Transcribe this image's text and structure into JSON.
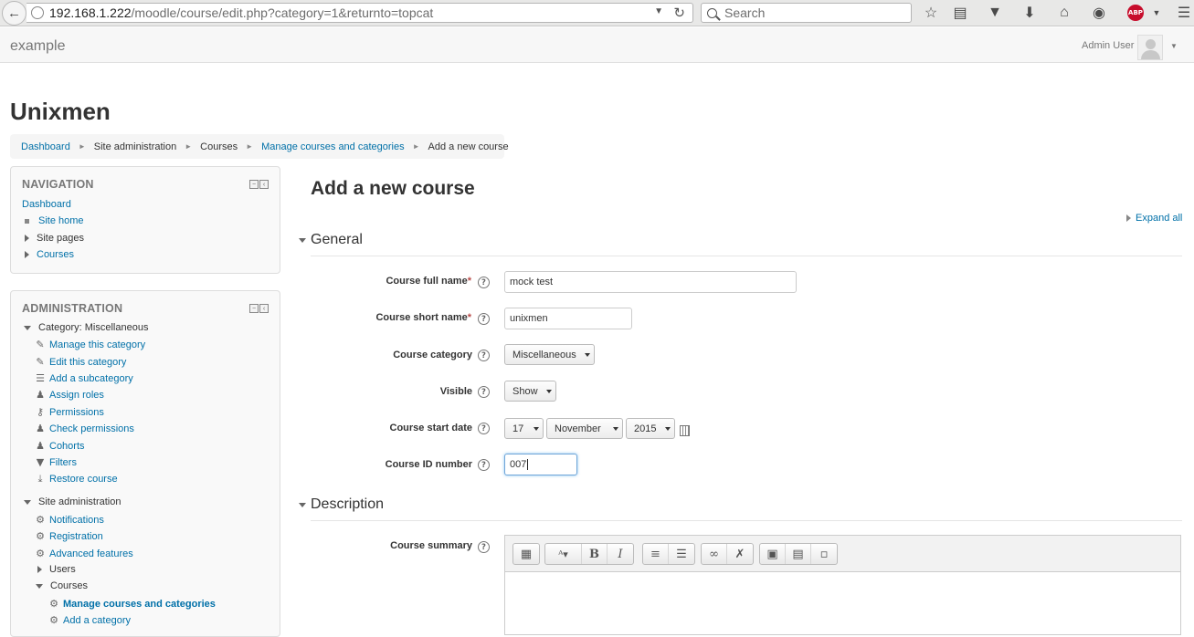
{
  "browser": {
    "url_host": "192.168.1.222",
    "url_path": "/moodle/course/edit.php?category=1&returnto=topcat",
    "search_placeholder": "Search",
    "abp_label": "ABP"
  },
  "header": {
    "site_name": "example",
    "user_name": "Admin User"
  },
  "page": {
    "heading": "Unixmen",
    "breadcrumb": [
      {
        "label": "Dashboard"
      },
      {
        "label": "Site administration"
      },
      {
        "label": "Courses"
      },
      {
        "label": "Manage courses and categories"
      },
      {
        "label": "Add a new course"
      }
    ]
  },
  "navigation": {
    "title": "NAVIGATION",
    "items": [
      {
        "label": "Dashboard"
      },
      {
        "label": "Site home"
      },
      {
        "label": "Site pages"
      },
      {
        "label": "Courses"
      }
    ]
  },
  "administration": {
    "title": "ADMINISTRATION",
    "category_label": "Category: Miscellaneous",
    "category_items": [
      {
        "label": "Manage this category",
        "icon": "pencil-icon"
      },
      {
        "label": "Edit this category",
        "icon": "pencil-icon"
      },
      {
        "label": "Add a subcategory",
        "icon": "list-icon"
      },
      {
        "label": "Assign roles",
        "icon": "user-icon"
      },
      {
        "label": "Permissions",
        "icon": "key-icon"
      },
      {
        "label": "Check permissions",
        "icon": "user-icon"
      },
      {
        "label": "Cohorts",
        "icon": "users-icon"
      },
      {
        "label": "Filters",
        "icon": "filter-icon"
      },
      {
        "label": "Restore course",
        "icon": "restore-icon"
      }
    ],
    "site_admin_label": "Site administration",
    "site_admin_items": [
      {
        "label": "Notifications",
        "icon": "gear-icon"
      },
      {
        "label": "Registration",
        "icon": "gear-icon"
      },
      {
        "label": "Advanced features",
        "icon": "gear-icon"
      },
      {
        "label": "Users"
      },
      {
        "label": "Courses"
      },
      {
        "label": "Manage courses and categories",
        "icon": "gear-icon"
      },
      {
        "label": "Add a category",
        "icon": "gear-icon"
      }
    ]
  },
  "form": {
    "heading": "Add a new course",
    "expand_all": "Expand all",
    "general_legend": "General",
    "description_legend": "Description",
    "fields": {
      "fullname": {
        "label": "Course full name",
        "value": "mock test"
      },
      "shortname": {
        "label": "Course short name",
        "value": "unixmen"
      },
      "category": {
        "label": "Course category",
        "value": "Miscellaneous"
      },
      "visible": {
        "label": "Visible",
        "value": "Show"
      },
      "startdate": {
        "label": "Course start date",
        "day": "17",
        "month": "November",
        "year": "2015"
      },
      "idnumber": {
        "label": "Course ID number",
        "value": "007"
      },
      "summary": {
        "label": "Course summary"
      }
    },
    "required_mark": "*",
    "help_glyph": "?"
  },
  "colors": {
    "link": "#0070a8",
    "required": "#b94a48",
    "abp_red": "#c70d2c"
  }
}
